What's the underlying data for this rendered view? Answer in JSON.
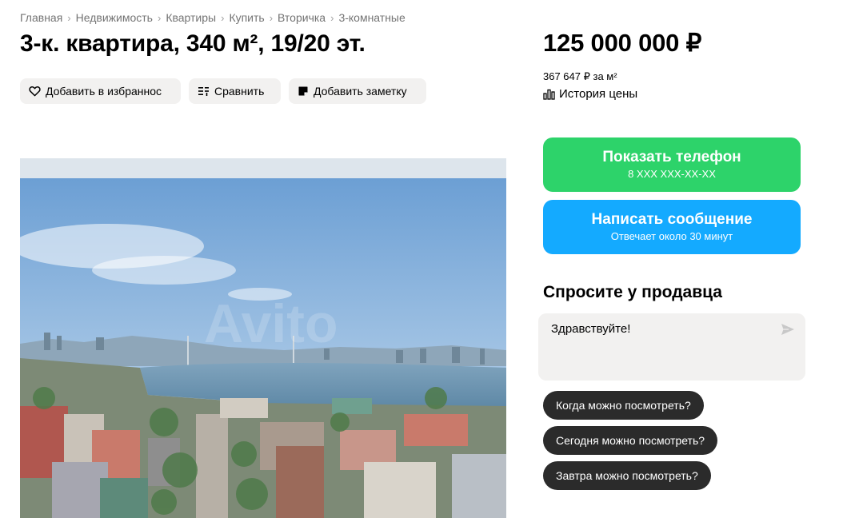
{
  "breadcrumb": [
    "Главная",
    "Недвижимость",
    "Квартиры",
    "Купить",
    "Вторичка",
    "3-комнатные"
  ],
  "listing": {
    "title": "3-к. квартира, 340 м², 19/20 эт.",
    "actions": {
      "favorite": "Добавить в избраннос",
      "compare": "Сравнить",
      "note": "Добавить заметку"
    },
    "watermark": "Avito"
  },
  "pricing": {
    "price": "125 000 000 ₽",
    "per_m2": "367 647 ₽ за м²",
    "history": "История цены"
  },
  "contact": {
    "phone_label": "Показать телефон",
    "phone_masked": "8 XXX XXX-XX-XX",
    "message_label": "Написать сообщение",
    "message_sub": "Отвечает около 30 минут"
  },
  "ask": {
    "title": "Спросите у продавца",
    "text": "Здравствуйте!",
    "chips": [
      "Когда можно посмотреть?",
      "Сегодня можно посмотреть?",
      "Завтра можно посмотреть?"
    ]
  },
  "colors": {
    "phone_button": "#2dd36a",
    "message_button": "#14aaff",
    "chip": "#2b2b2b",
    "button_bg": "#f2f1f0"
  }
}
